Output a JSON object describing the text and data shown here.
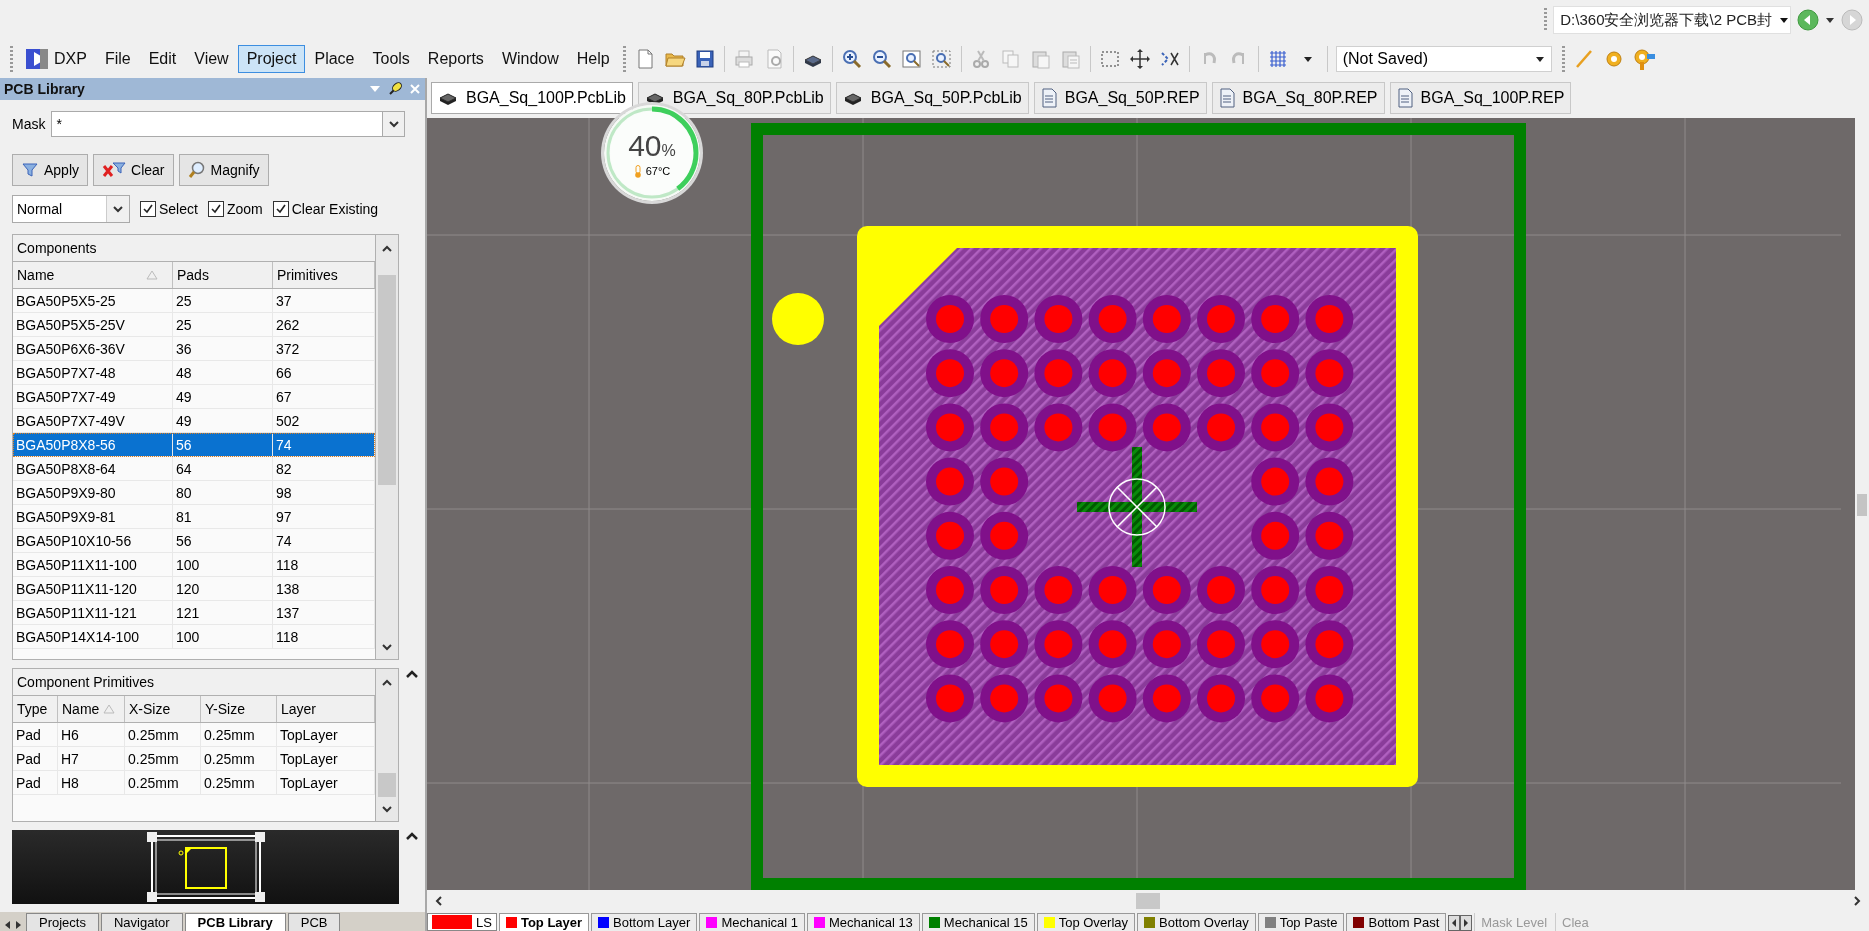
{
  "title_bar": {
    "path": "D:\\360安全浏览器下载\\2 PCB封"
  },
  "menu": [
    {
      "label": "DXP",
      "kind": "app",
      "selected": false
    },
    {
      "label": "File",
      "kind": "menu",
      "selected": false
    },
    {
      "label": "Edit",
      "kind": "menu",
      "selected": false
    },
    {
      "label": "View",
      "kind": "menu",
      "selected": false
    },
    {
      "label": "Project",
      "kind": "menu",
      "selected": true
    },
    {
      "label": "Place",
      "kind": "menu",
      "selected": false
    },
    {
      "label": "Tools",
      "kind": "menu",
      "selected": false
    },
    {
      "label": "Reports",
      "kind": "menu",
      "selected": false
    },
    {
      "label": "Window",
      "kind": "menu",
      "selected": false
    },
    {
      "label": "Help",
      "kind": "menu",
      "selected": false
    }
  ],
  "toolbar": {
    "view_config": "(Not Saved)"
  },
  "panel": {
    "title": "PCB Library",
    "mask": {
      "label": "Mask",
      "value": "*"
    },
    "buttons": [
      {
        "label": "Apply",
        "kind": "apply"
      },
      {
        "label": "Clear",
        "kind": "clear"
      },
      {
        "label": "Magnify",
        "kind": "magnify"
      }
    ],
    "mode": "Normal",
    "options": [
      {
        "label": "Select",
        "checked": true
      },
      {
        "label": "Zoom",
        "checked": true
      },
      {
        "label": "Clear Existing",
        "checked": true
      }
    ],
    "components": {
      "title": "Components",
      "columns": [
        "Name",
        "Pads",
        "Primitives"
      ],
      "rows": [
        {
          "cells": [
            "BGA50P5X5-25",
            "25",
            "37"
          ],
          "selected": false
        },
        {
          "cells": [
            "BGA50P5X5-25V",
            "25",
            "262"
          ],
          "selected": false
        },
        {
          "cells": [
            "BGA50P6X6-36V",
            "36",
            "372"
          ],
          "selected": false
        },
        {
          "cells": [
            "BGA50P7X7-48",
            "48",
            "66"
          ],
          "selected": false
        },
        {
          "cells": [
            "BGA50P7X7-49",
            "49",
            "67"
          ],
          "selected": false
        },
        {
          "cells": [
            "BGA50P7X7-49V",
            "49",
            "502"
          ],
          "selected": false
        },
        {
          "cells": [
            "BGA50P8X8-56",
            "56",
            "74"
          ],
          "selected": true
        },
        {
          "cells": [
            "BGA50P8X8-64",
            "64",
            "82"
          ],
          "selected": false
        },
        {
          "cells": [
            "BGA50P9X9-80",
            "80",
            "98"
          ],
          "selected": false
        },
        {
          "cells": [
            "BGA50P9X9-81",
            "81",
            "97"
          ],
          "selected": false
        },
        {
          "cells": [
            "BGA50P10X10-56",
            "56",
            "74"
          ],
          "selected": false
        },
        {
          "cells": [
            "BGA50P11X11-100",
            "100",
            "118"
          ],
          "selected": false
        },
        {
          "cells": [
            "BGA50P11X11-120",
            "120",
            "138"
          ],
          "selected": false
        },
        {
          "cells": [
            "BGA50P11X11-121",
            "121",
            "137"
          ],
          "selected": false
        },
        {
          "cells": [
            "BGA50P14X14-100",
            "100",
            "118"
          ],
          "selected": false
        }
      ]
    },
    "primitives": {
      "title": "Component Primitives",
      "columns": [
        "Type",
        "Name",
        "X-Size",
        "Y-Size",
        "Layer"
      ],
      "rows": [
        [
          "Pad",
          "H6",
          "0.25mm",
          "0.25mm",
          "TopLayer"
        ],
        [
          "Pad",
          "H7",
          "0.25mm",
          "0.25mm",
          "TopLayer"
        ],
        [
          "Pad",
          "H8",
          "0.25mm",
          "0.25mm",
          "TopLayer"
        ]
      ]
    },
    "tabs": [
      {
        "label": "Projects",
        "selected": false
      },
      {
        "label": "Navigator",
        "selected": false
      },
      {
        "label": "PCB Library",
        "selected": true
      },
      {
        "label": "PCB",
        "selected": false
      }
    ]
  },
  "doc_tabs": [
    {
      "label": "BGA_Sq_100P.PcbLib",
      "kind": "pcblib",
      "selected": true
    },
    {
      "label": "BGA_Sq_80P.PcbLib",
      "kind": "pcblib",
      "selected": false
    },
    {
      "label": "BGA_Sq_50P.PcbLib",
      "kind": "pcblib",
      "selected": false
    },
    {
      "label": "BGA_Sq_50P.REP",
      "kind": "report",
      "selected": false
    },
    {
      "label": "BGA_Sq_80P.REP",
      "kind": "report",
      "selected": false
    },
    {
      "label": "BGA_Sq_100P.REP",
      "kind": "report",
      "selected": false
    }
  ],
  "badge": {
    "percent": "40",
    "unit": "%",
    "temperature": "67°C",
    "level": 0.4
  },
  "layers": {
    "current": "LS",
    "tabs": [
      {
        "label": "Top Layer",
        "color": "#ff0000",
        "selected": true
      },
      {
        "label": "Bottom Layer",
        "color": "#0000ff",
        "selected": false
      },
      {
        "label": "Mechanical 1",
        "color": "#ff00ff",
        "selected": false
      },
      {
        "label": "Mechanical 13",
        "color": "#ff00ff",
        "selected": false
      },
      {
        "label": "Mechanical 15",
        "color": "#008000",
        "selected": false
      },
      {
        "label": "Top Overlay",
        "color": "#ffff00",
        "selected": false
      },
      {
        "label": "Bottom Overlay",
        "color": "#808000",
        "selected": false
      },
      {
        "label": "Top Paste",
        "color": "#808080",
        "selected": false
      },
      {
        "label": "Bottom Past",
        "color": "#800000",
        "selected": false
      }
    ],
    "extra": [
      "Mask Level",
      "Clea"
    ]
  }
}
